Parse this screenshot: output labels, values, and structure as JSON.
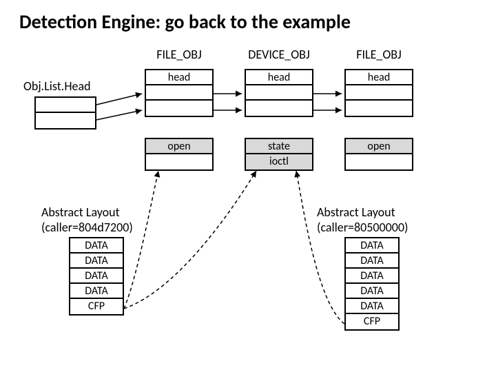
{
  "title": "Detection Engine: go back to the example",
  "columns": {
    "left": "FILE_OBJ",
    "mid": "DEVICE_OBJ",
    "right": "FILE_OBJ"
  },
  "rowLabel": "Obj.List.Head",
  "headBoxes": {
    "left": {
      "r1": "head",
      "r2": "",
      "r3": ""
    },
    "mid": {
      "r1": "head",
      "r2": "",
      "r3": ""
    },
    "right": {
      "r1": "head",
      "r2": "",
      "r3": ""
    }
  },
  "opBoxes": {
    "left": {
      "r1": "open",
      "r2": ""
    },
    "mid": {
      "r1": "state",
      "r2": "ioctl"
    },
    "right": {
      "r1": "open",
      "r2": ""
    }
  },
  "abstractLeft": {
    "caption1": "Abstract Layout",
    "caption2": "(caller=804d7200)",
    "rows": [
      "DATA",
      "DATA",
      "DATA",
      "DATA",
      "CFP"
    ]
  },
  "abstractRight": {
    "caption1": "Abstract Layout",
    "caption2": "(caller=80500000)",
    "rows": [
      "DATA",
      "DATA",
      "DATA",
      "DATA",
      "DATA",
      "CFP"
    ]
  }
}
